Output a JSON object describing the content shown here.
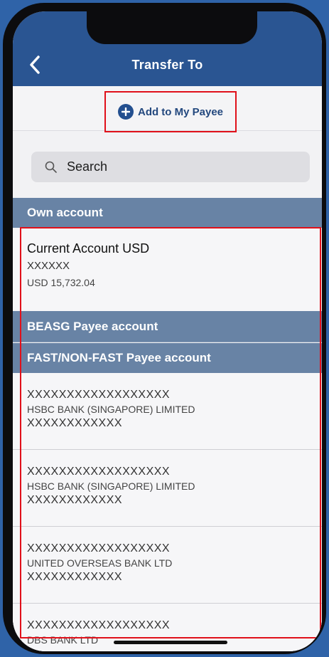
{
  "header": {
    "title": "Transfer To",
    "back_icon": "chevron-left-icon"
  },
  "add_payee": {
    "label": "Add to My Payee",
    "icon": "plus-circle-icon"
  },
  "search": {
    "placeholder": "Search",
    "icon": "search-icon"
  },
  "sections": {
    "own": "Own account",
    "beasg": "BEASG Payee account",
    "fast": "FAST/NON-FAST Payee account"
  },
  "own_account": {
    "name": "Current Account USD",
    "number": "XXXXXX",
    "balance": "USD 15,732.04"
  },
  "payees": [
    {
      "account": "XXXXXXXXXXXXXXXXXX",
      "bank": "HSBC BANK (SINGAPORE) LIMITED",
      "ref": "XXXXXXXXXXXX"
    },
    {
      "account": "XXXXXXXXXXXXXXXXXX",
      "bank": "HSBC BANK (SINGAPORE) LIMITED",
      "ref": "XXXXXXXXXXXX"
    },
    {
      "account": "XXXXXXXXXXXXXXXXXX",
      "bank": "UNITED OVERSEAS BANK LTD",
      "ref": "XXXXXXXXXXXX"
    },
    {
      "account": "XXXXXXXXXXXXXXXXXX",
      "bank": "DBS BANK LTD",
      "ref": ""
    }
  ],
  "colors": {
    "header": "#2a5592",
    "section_header": "#6883a5",
    "highlight_frame": "#e0101a",
    "accent_text": "#23487e"
  }
}
